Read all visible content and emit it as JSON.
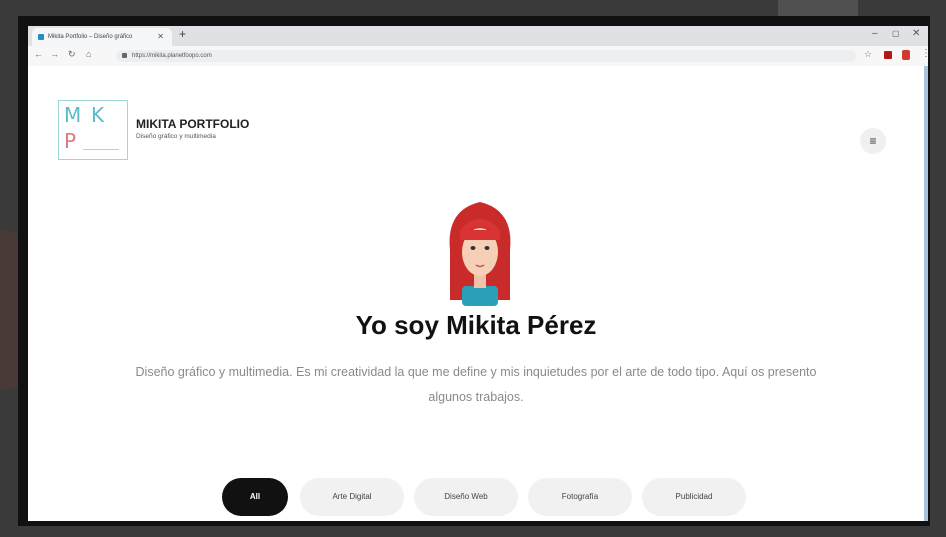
{
  "browser": {
    "tab_title": "Mikita Portfolio – Diseño gráfico",
    "new_tab_glyph": "+",
    "url": "https://mikita.planetfoopo.com",
    "window_controls": {
      "minimize": "–",
      "maximize": "▢",
      "close": "✕"
    }
  },
  "site": {
    "logo_letters": {
      "m": "M",
      "k": "K",
      "p": "P"
    },
    "title": "MIKITA PORTFOLIO",
    "subtitle": "Diseño gráfico y multimedia",
    "menu_icon": "≡"
  },
  "hero": {
    "headline": "Yo soy Mikita Pérez",
    "intro": "Diseño gráfico y multimedia. Es mi creatividad la que me define y mis inquietudes por el arte de todo tipo. Aquí os presento algunos trabajos."
  },
  "filters": [
    {
      "label": "All",
      "active": true
    },
    {
      "label": "Arte Digital",
      "active": false
    },
    {
      "label": "Diseño Web",
      "active": false
    },
    {
      "label": "Fotografía",
      "active": false
    },
    {
      "label": "Publicidad",
      "active": false
    }
  ],
  "colors": {
    "accent_highlight": "#a7dcef",
    "logo_teal": "#5bbcc9",
    "logo_pink": "#e07a7a",
    "avatar_hair": "#d42a2a"
  }
}
